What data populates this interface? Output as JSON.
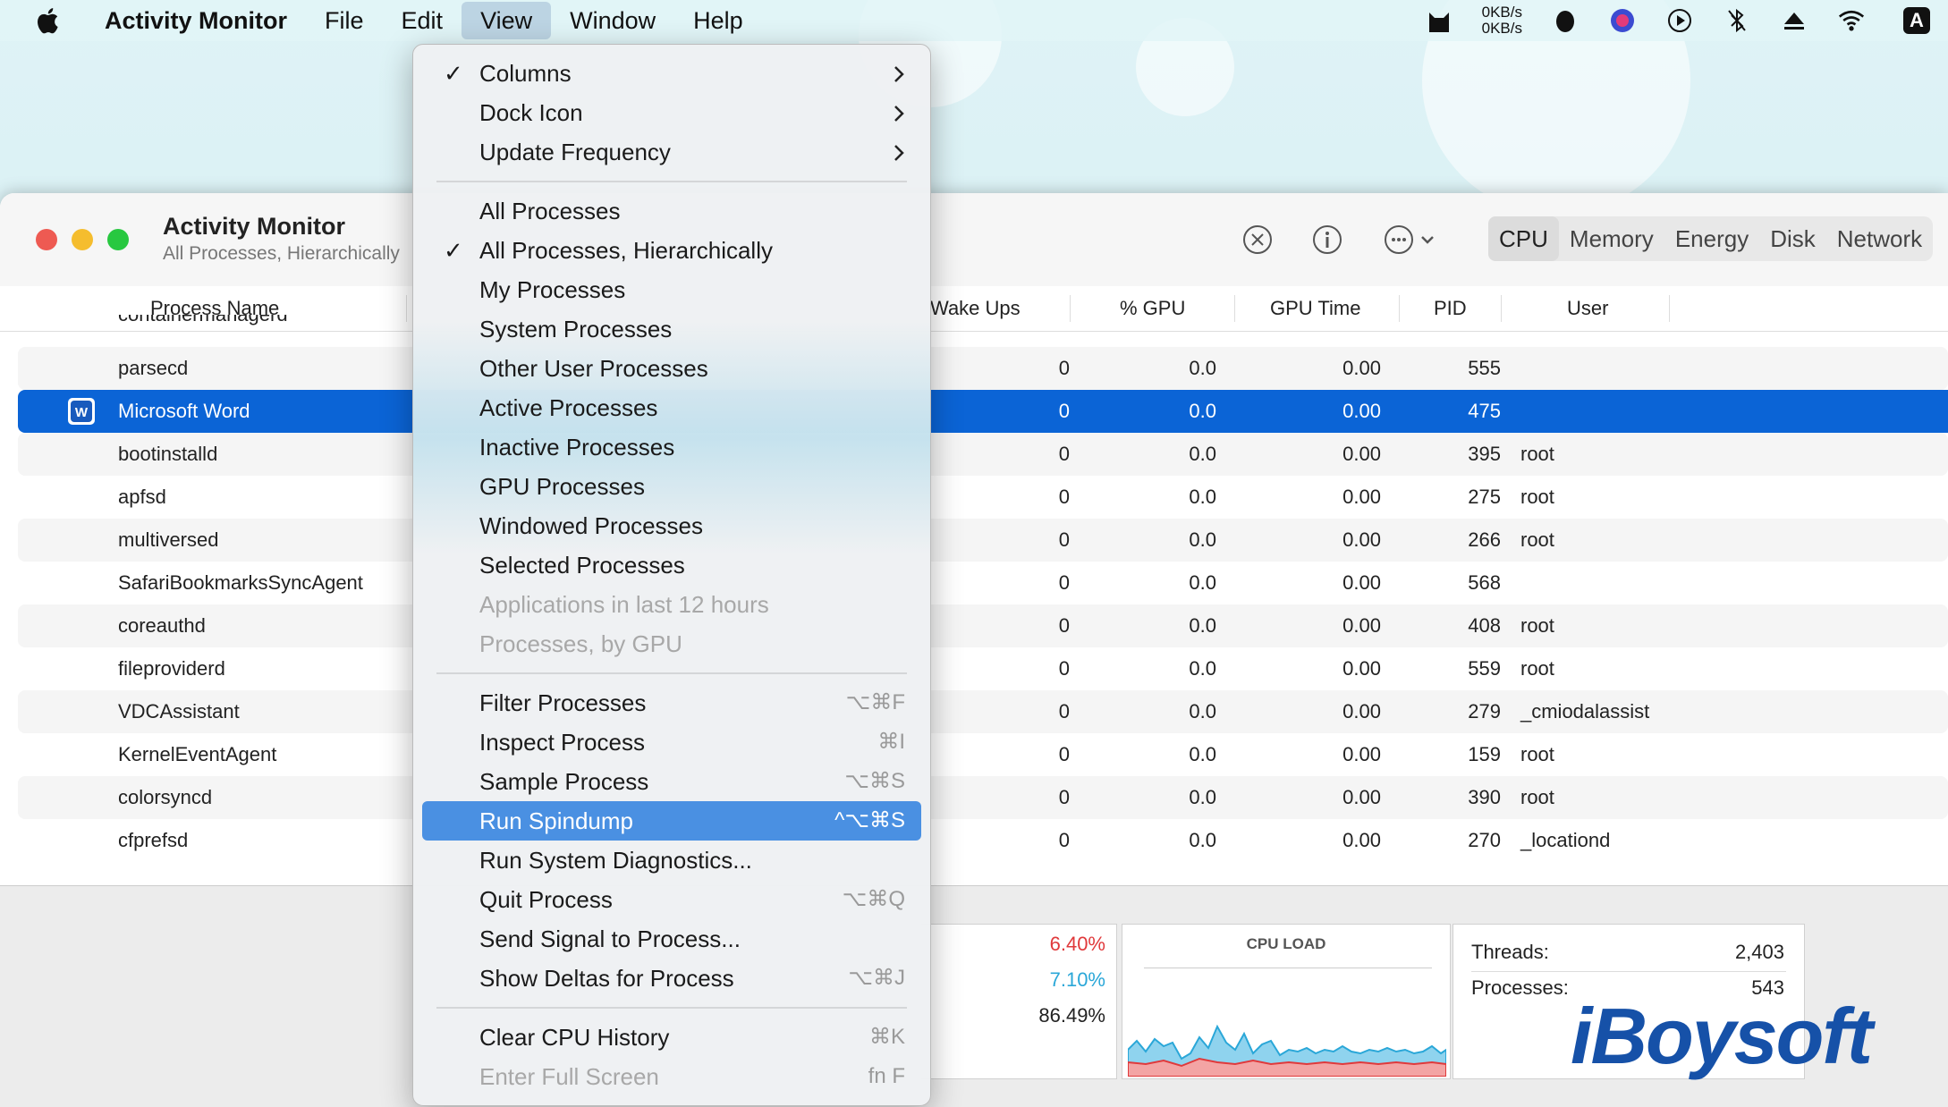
{
  "menubar": {
    "app_name": "Activity Monitor",
    "items": [
      "File",
      "Edit",
      "View",
      "Window",
      "Help"
    ],
    "netspeed_up": "0KB/s",
    "netspeed_down": "0KB/s",
    "keyboard_label": "A"
  },
  "window": {
    "title": "Activity Monitor",
    "subtitle": "All Processes, Hierarchically",
    "tabs": [
      "CPU",
      "Memory",
      "Energy",
      "Disk",
      "Network"
    ],
    "active_tab": "CPU"
  },
  "columns": {
    "process_name": "Process Name",
    "wake_ups": "Wake Ups",
    "gpu_pct": "% GPU",
    "gpu_time": "GPU Time",
    "pid": "PID",
    "user": "User"
  },
  "partial_top_row": "containermanagerd",
  "processes": [
    {
      "name": "parsecd",
      "wake": "0",
      "gpu": "0.0",
      "gtime": "0.00",
      "pid": "555",
      "user": ""
    },
    {
      "name": "Microsoft Word",
      "wake": "0",
      "gpu": "0.0",
      "gtime": "0.00",
      "pid": "475",
      "user": ""
    },
    {
      "name": "bootinstalld",
      "wake": "0",
      "gpu": "0.0",
      "gtime": "0.00",
      "pid": "395",
      "user": "root"
    },
    {
      "name": "apfsd",
      "wake": "0",
      "gpu": "0.0",
      "gtime": "0.00",
      "pid": "275",
      "user": "root"
    },
    {
      "name": "multiversed",
      "wake": "0",
      "gpu": "0.0",
      "gtime": "0.00",
      "pid": "266",
      "user": "root"
    },
    {
      "name": "SafariBookmarksSyncAgent",
      "wake": "0",
      "gpu": "0.0",
      "gtime": "0.00",
      "pid": "568",
      "user": ""
    },
    {
      "name": "coreauthd",
      "wake": "0",
      "gpu": "0.0",
      "gtime": "0.00",
      "pid": "408",
      "user": "root"
    },
    {
      "name": "fileproviderd",
      "wake": "0",
      "gpu": "0.0",
      "gtime": "0.00",
      "pid": "559",
      "user": "root"
    },
    {
      "name": "VDCAssistant",
      "wake": "0",
      "gpu": "0.0",
      "gtime": "0.00",
      "pid": "279",
      "user": "_cmiodalassist"
    },
    {
      "name": "KernelEventAgent",
      "wake": "0",
      "gpu": "0.0",
      "gtime": "0.00",
      "pid": "159",
      "user": "root"
    },
    {
      "name": "colorsyncd",
      "wake": "0",
      "gpu": "0.0",
      "gtime": "0.00",
      "pid": "390",
      "user": "root"
    },
    {
      "name": "cfprefsd",
      "wake": "0",
      "gpu": "0.0",
      "gtime": "0.00",
      "pid": "270",
      "user": "_locationd"
    }
  ],
  "bottom": {
    "system_pct": "6.40%",
    "user_pct": "7.10%",
    "idle_pct": "86.49%",
    "cpu_load_label": "CPU LOAD",
    "threads_label": "Threads:",
    "threads_value": "2,403",
    "processes_label": "Processes:",
    "processes_value": "543"
  },
  "view_menu": [
    {
      "label": "Columns",
      "check": true,
      "submenu": true,
      "shortcut": "",
      "disabled": false
    },
    {
      "label": "Dock Icon",
      "check": false,
      "submenu": true,
      "shortcut": "",
      "disabled": false
    },
    {
      "label": "Update Frequency",
      "check": false,
      "submenu": true,
      "shortcut": "",
      "disabled": false
    },
    {
      "label": "All Processes",
      "check": false,
      "submenu": false,
      "shortcut": "",
      "disabled": false
    },
    {
      "label": "All Processes, Hierarchically",
      "check": true,
      "submenu": false,
      "shortcut": "",
      "disabled": false
    },
    {
      "label": "My Processes",
      "check": false,
      "submenu": false,
      "shortcut": "",
      "disabled": false
    },
    {
      "label": "System Processes",
      "check": false,
      "submenu": false,
      "shortcut": "",
      "disabled": false
    },
    {
      "label": "Other User Processes",
      "check": false,
      "submenu": false,
      "shortcut": "",
      "disabled": false
    },
    {
      "label": "Active Processes",
      "check": false,
      "submenu": false,
      "shortcut": "",
      "disabled": false
    },
    {
      "label": "Inactive Processes",
      "check": false,
      "submenu": false,
      "shortcut": "",
      "disabled": false
    },
    {
      "label": "GPU Processes",
      "check": false,
      "submenu": false,
      "shortcut": "",
      "disabled": false
    },
    {
      "label": "Windowed Processes",
      "check": false,
      "submenu": false,
      "shortcut": "",
      "disabled": false
    },
    {
      "label": "Selected Processes",
      "check": false,
      "submenu": false,
      "shortcut": "",
      "disabled": false
    },
    {
      "label": "Applications in last 12 hours",
      "check": false,
      "submenu": false,
      "shortcut": "",
      "disabled": true
    },
    {
      "label": "Processes, by GPU",
      "check": false,
      "submenu": false,
      "shortcut": "",
      "disabled": true
    },
    {
      "label": "Filter Processes",
      "check": false,
      "submenu": false,
      "shortcut": "⌥⌘F",
      "disabled": false
    },
    {
      "label": "Inspect Process",
      "check": false,
      "submenu": false,
      "shortcut": "⌘I",
      "disabled": false
    },
    {
      "label": "Sample Process",
      "check": false,
      "submenu": false,
      "shortcut": "⌥⌘S",
      "disabled": false
    },
    {
      "label": "Run Spindump",
      "check": false,
      "submenu": false,
      "shortcut": "^⌥⌘S",
      "disabled": false,
      "highlighted": true
    },
    {
      "label": "Run System Diagnostics...",
      "check": false,
      "submenu": false,
      "shortcut": "",
      "disabled": false
    },
    {
      "label": "Quit Process",
      "check": false,
      "submenu": false,
      "shortcut": "⌥⌘Q",
      "disabled": false
    },
    {
      "label": "Send Signal to Process...",
      "check": false,
      "submenu": false,
      "shortcut": "",
      "disabled": false
    },
    {
      "label": "Show Deltas for Process",
      "check": false,
      "submenu": false,
      "shortcut": "⌥⌘J",
      "disabled": false
    },
    {
      "label": "Clear CPU History",
      "check": false,
      "submenu": false,
      "shortcut": "⌘K",
      "disabled": false
    },
    {
      "label": "Enter Full Screen",
      "check": false,
      "submenu": false,
      "shortcut": "fn F",
      "disabled": true
    }
  ],
  "watermark": "iBoysoft",
  "colors": {
    "selection": "#0b64d6",
    "menu_highlight": "#4a90e2",
    "system_cpu": "#e0393b",
    "user_cpu": "#2aa7d8",
    "brand": "#1651a8"
  }
}
